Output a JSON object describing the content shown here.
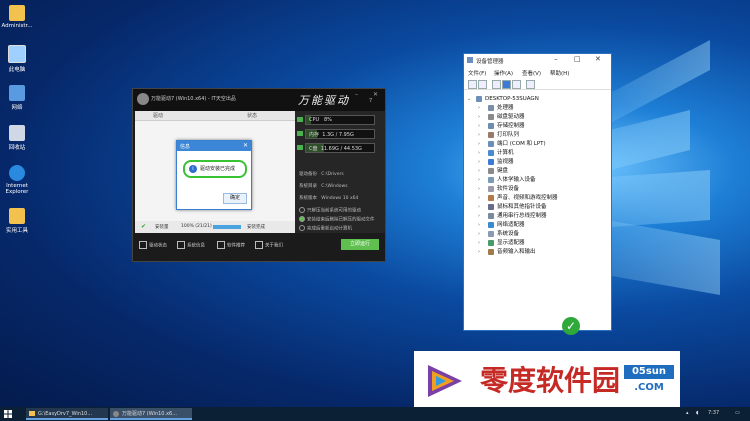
{
  "desktop": {
    "icons": [
      {
        "label": "Administr...",
        "icon": "folder-icon"
      },
      {
        "label": "此电脑",
        "icon": "computer-icon"
      },
      {
        "label": "网络",
        "icon": "network-icon"
      },
      {
        "label": "回收站",
        "icon": "recycle-bin-icon"
      },
      {
        "label": "Internet Explorer",
        "icon": "ie-icon"
      },
      {
        "label": "实用工具",
        "icon": "folder-icon"
      }
    ]
  },
  "driver_window": {
    "title": "万能驱动7 (Win10.x64) - IT天空出品",
    "brand": "万能驱动",
    "version": "7",
    "columns": [
      "驱动",
      "状态"
    ],
    "meters": [
      {
        "label": "CPU",
        "value": "8%",
        "fill": 0.08
      },
      {
        "label": "内存",
        "value": "1.3G / 7.95G",
        "fill": 0.16
      },
      {
        "label": "C盘",
        "value": "11.69G / 44.53G",
        "fill": 0.26
      }
    ],
    "info": [
      {
        "label": "驱动备份",
        "value": "C:\\Drivers"
      },
      {
        "label": "系统目录",
        "value": "C:\\Windows"
      },
      {
        "label": "系统版本",
        "value": "Windows 10 x64"
      }
    ],
    "options": [
      "只解压当前系统可用的驱动",
      "安装结束后删除已解压的驱动文件",
      "完成后重新启动计算机"
    ],
    "status": {
      "label": "安装量",
      "progress_text": "100% (21/21)",
      "progress": 1.0,
      "result": "安装完成"
    },
    "action_button": "立即运行",
    "bottom_buttons": [
      "驱动状态",
      "系统信息",
      "软件推荐",
      "关于我们"
    ]
  },
  "dialog": {
    "title": "信息",
    "message": "驱动安装已完成",
    "ok": "确定"
  },
  "device_manager": {
    "title": "设备管理器",
    "menu": [
      "文件(F)",
      "操作(A)",
      "查看(V)",
      "帮助(H)"
    ],
    "root": "DESKTOP-53SUAGN",
    "devices": [
      {
        "label": "处理器",
        "icon": "cpu-icon"
      },
      {
        "label": "磁盘驱动器",
        "icon": "disk-icon"
      },
      {
        "label": "存储控制器",
        "icon": "storage-icon"
      },
      {
        "label": "打印队列",
        "icon": "printer-icon"
      },
      {
        "label": "端口 (COM 和 LPT)",
        "icon": "port-icon"
      },
      {
        "label": "计算机",
        "icon": "computer-icon"
      },
      {
        "label": "监视器",
        "icon": "monitor-icon"
      },
      {
        "label": "键盘",
        "icon": "keyboard-icon"
      },
      {
        "label": "人体学输入设备",
        "icon": "hid-icon"
      },
      {
        "label": "软件设备",
        "icon": "software-device-icon"
      },
      {
        "label": "声音、视频和游戏控制器",
        "icon": "sound-icon"
      },
      {
        "label": "鼠标和其他指针设备",
        "icon": "mouse-icon"
      },
      {
        "label": "通用串行总线控制器",
        "icon": "usb-icon"
      },
      {
        "label": "网络适配器",
        "icon": "network-adapter-icon"
      },
      {
        "label": "系统设备",
        "icon": "system-device-icon"
      },
      {
        "label": "显示适配器",
        "icon": "display-adapter-icon"
      },
      {
        "label": "音频输入和输出",
        "icon": "audio-io-icon"
      }
    ]
  },
  "watermark": {
    "text": "零度软件园",
    "site": "05sun",
    "domain": ".COM"
  },
  "taskbar": {
    "tasks": [
      {
        "label": "G:\\EasyDrv7_Win10..."
      },
      {
        "label": "万能驱动7 (Win10.x6..."
      }
    ],
    "clock": "7:37",
    "colors": {
      "accent": "#3b86d6",
      "success": "#39c234"
    }
  }
}
